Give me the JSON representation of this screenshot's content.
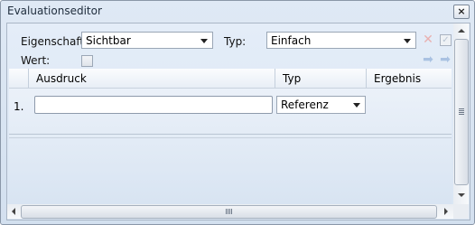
{
  "window": {
    "title": "Evaluationseditor",
    "close_glyph": "×"
  },
  "form": {
    "eigenschaft_label": "Eigenschaft",
    "eigenschaft_value": "Sichtbar",
    "typ_label": "Typ:",
    "typ_value": "Einfach",
    "wert_label": "Wert:",
    "wert_checked": false
  },
  "toolbar_icons": [
    "delete-icon",
    "check-icon",
    "arrow-left-icon",
    "arrow-right-icon"
  ],
  "grid": {
    "columns": [
      "Ausdruck",
      "Typ",
      "Ergebnis"
    ],
    "rows": [
      {
        "num": "1.",
        "ausdruck": "",
        "typ": "Referenz",
        "ergebnis": ""
      }
    ]
  },
  "colors": {
    "accent_red": "#e03030",
    "disabled": "#b8c4d2",
    "arrow_blue": "#8fb0d8"
  }
}
